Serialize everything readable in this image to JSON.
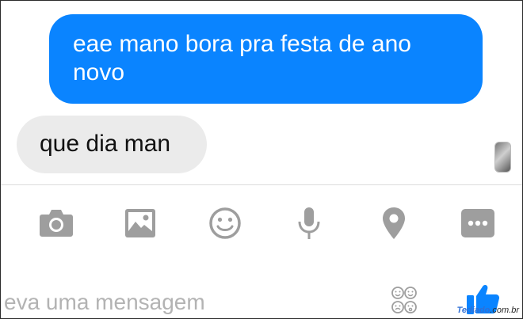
{
  "conversation": {
    "sent_message": "eae mano bora pra festa de ano novo",
    "received_message": "que dia man"
  },
  "toolbar": {
    "icons": [
      "camera-icon",
      "image-icon",
      "emoji-icon",
      "microphone-icon",
      "location-icon",
      "more-icon"
    ]
  },
  "composer": {
    "placeholder": "eva uma mensagem",
    "like_icon": "thumbs-up-icon"
  },
  "watermark": {
    "brand": "Tediado",
    "suffix": ".com.br"
  },
  "colors": {
    "accent": "#0a84ff",
    "received_bubble": "#ebebeb",
    "icon_gray": "#9e9e9e"
  }
}
